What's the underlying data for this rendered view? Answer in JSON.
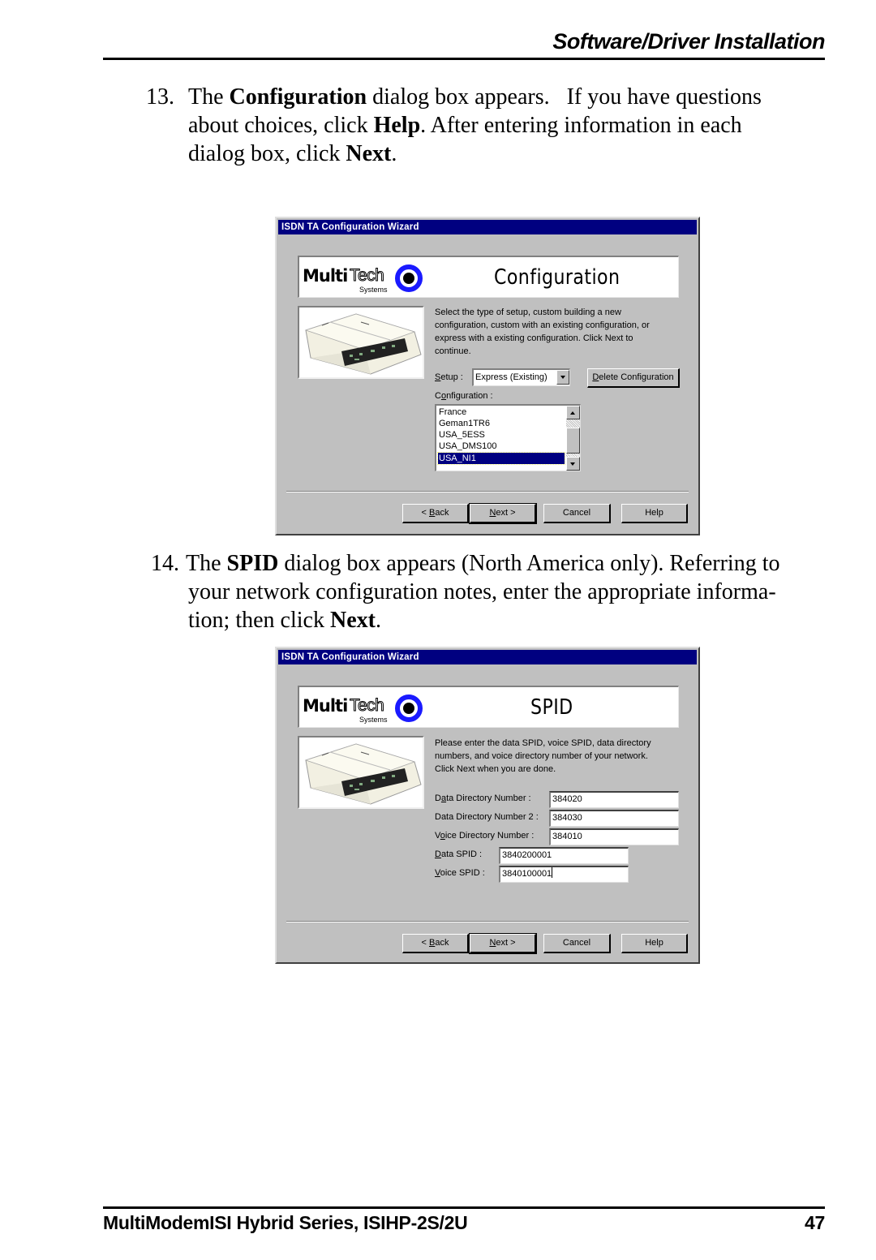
{
  "header": {
    "section_title": "Software/Driver Installation"
  },
  "steps": [
    {
      "number": "13.",
      "lines": [
        {
          "parts": [
            "The ",
            "Configuration",
            " dialog box appears.   If you have questions"
          ]
        },
        {
          "parts": [
            "about choices, click ",
            "Help",
            ". After entering information in each"
          ]
        },
        {
          "parts": [
            "dialog box, click ",
            "Next",
            "."
          ]
        }
      ]
    },
    {
      "number": "14.",
      "lines": [
        {
          "parts": [
            "The ",
            "SPID",
            " dialog box appears (North America only). Referring to"
          ]
        },
        {
          "parts": [
            "your network configuration notes, enter the appropriate informa-",
            "",
            ""
          ]
        },
        {
          "parts": [
            "tion; then click ",
            "Next",
            "."
          ]
        }
      ]
    }
  ],
  "dialog_config": {
    "window_title": "ISDN TA Configuration Wizard",
    "logo": {
      "brand_bold": "Multi",
      "brand_outline": "Tech",
      "brand_sub": "Systems",
      "ring_color": "#1a1aff"
    },
    "banner_title": "Configuration",
    "description": "Select the type of setup, custom building a new configuration, custom with an existing configuration, or express with a existing configuration.  Click Next to continue.",
    "setup_label": {
      "u": "S",
      "rest": "etup :"
    },
    "setup_value": "Express (Existing)",
    "delete_button": {
      "u": "D",
      "rest": "elete Configuration"
    },
    "configuration_label": {
      "pre": "C",
      "u": "o",
      "rest": "nfiguration :"
    },
    "configurations": [
      "France",
      "Geman1TR6",
      "USA_5ESS",
      "USA_DMS100",
      "USA_NI1"
    ],
    "selected_configuration": "USA_NI1",
    "buttons": {
      "back": {
        "pre": "< ",
        "u": "B",
        "rest": "ack"
      },
      "next": {
        "pre": "",
        "u": "N",
        "rest": "ext >"
      },
      "cancel": "Cancel",
      "help": "Help"
    }
  },
  "dialog_spid": {
    "window_title": "ISDN TA Configuration Wizard",
    "logo": {
      "brand_bold": "Multi",
      "brand_outline": "Tech",
      "brand_sub": "Systems",
      "ring_color": "#1a1aff"
    },
    "banner_title": "SPID",
    "description_lines": [
      "Please enter the data SPID, voice SPID, data directory",
      "numbers, and voice directory number of your network.",
      "Click Next when you are done."
    ],
    "fields": [
      {
        "label_pre": "D",
        "label_u": "a",
        "label_rest": "ta Directory Number :",
        "value": "384020"
      },
      {
        "label_pre": "Data Directory Number 2 :",
        "label_u": "",
        "label_rest": "",
        "value": "384030"
      },
      {
        "label_pre": "V",
        "label_u": "o",
        "label_rest": "ice Directory Number :",
        "value": "384010"
      },
      {
        "label_pre": "",
        "label_u": "D",
        "label_rest": "ata SPID :",
        "value": "3840200001"
      },
      {
        "label_pre": "",
        "label_u": "V",
        "label_rest": "oice SPID :",
        "value": "3840100001"
      }
    ],
    "buttons": {
      "back": {
        "pre": "< ",
        "u": "B",
        "rest": "ack"
      },
      "next": {
        "pre": "",
        "u": "N",
        "rest": "ext >"
      },
      "cancel": "Cancel",
      "help": "Help"
    }
  },
  "footer": {
    "product": "MultiModemISI Hybrid Series, ISIHP-2S/2U",
    "page_number": "47"
  }
}
